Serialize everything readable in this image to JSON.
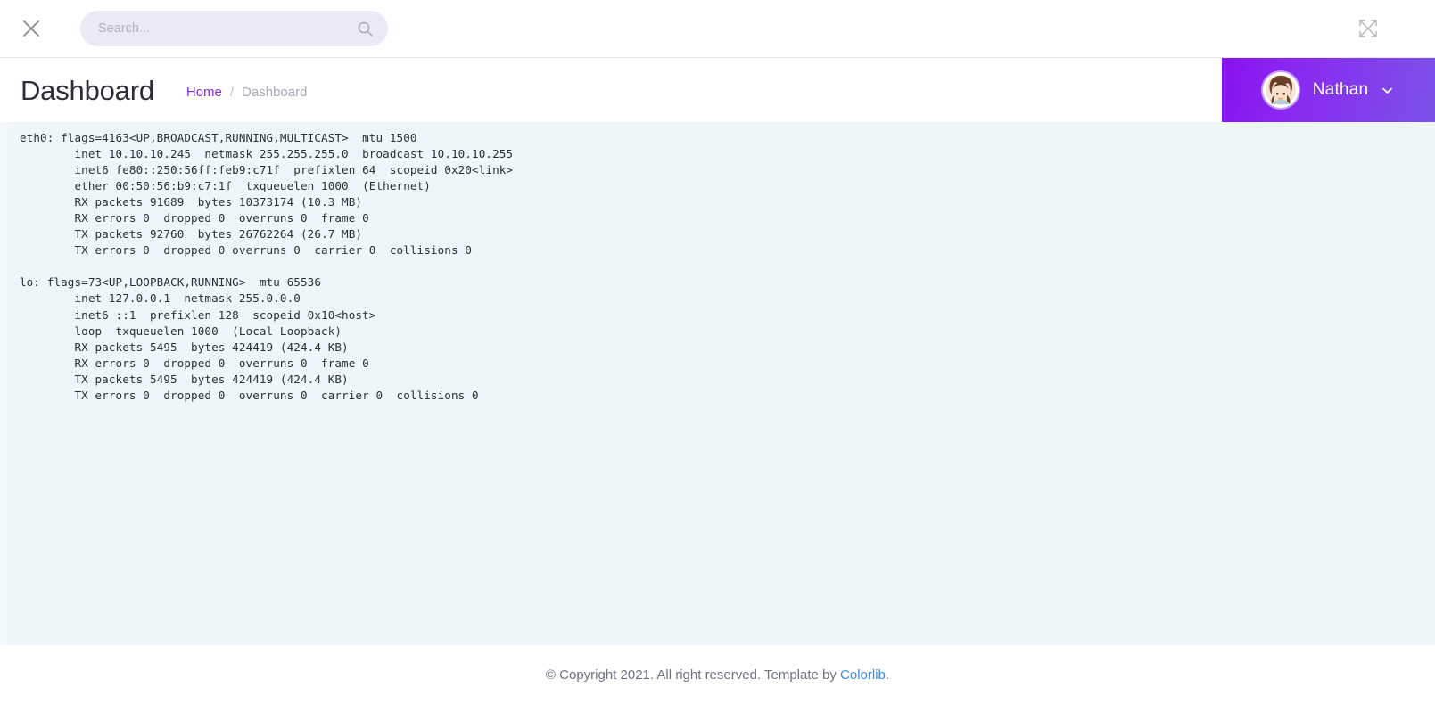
{
  "topbar": {
    "close_icon": "close-icon",
    "search": {
      "value": "",
      "placeholder": "Search...",
      "icon": "search-icon"
    },
    "fullscreen_icon": "expand-icon"
  },
  "header": {
    "title": "Dashboard",
    "breadcrumb": {
      "home_label": "Home",
      "separator": "/",
      "current_label": "Dashboard"
    },
    "user": {
      "name": "Nathan",
      "avatar_icon": "user-avatar",
      "caret_icon": "chevron-down-icon"
    }
  },
  "content": {
    "terminal_output": "eth0: flags=4163<UP,BROADCAST,RUNNING,MULTICAST>  mtu 1500\n        inet 10.10.10.245  netmask 255.255.255.0  broadcast 10.10.10.255\n        inet6 fe80::250:56ff:feb9:c71f  prefixlen 64  scopeid 0x20<link>\n        ether 00:50:56:b9:c7:1f  txqueuelen 1000  (Ethernet)\n        RX packets 91689  bytes 10373174 (10.3 MB)\n        RX errors 0  dropped 0  overruns 0  frame 0\n        TX packets 92760  bytes 26762264 (26.7 MB)\n        TX errors 0  dropped 0 overruns 0  carrier 0  collisions 0\n\nlo: flags=73<UP,LOOPBACK,RUNNING>  mtu 65536\n        inet 127.0.0.1  netmask 255.0.0.0\n        inet6 ::1  prefixlen 128  scopeid 0x10<host>\n        loop  txqueuelen 1000  (Local Loopback)\n        RX packets 5495  bytes 424419 (424.4 KB)\n        RX errors 0  dropped 0  overruns 0  frame 0\n        TX packets 5495  bytes 424419 (424.4 KB)\n        TX errors 0  dropped 0  overruns 0  carrier 0  collisions 0"
  },
  "footer": {
    "copyright_text": "© Copyright 2021. All right reserved. Template by ",
    "link_label": "Colorlib",
    "trailing": "."
  },
  "colors": {
    "accent_purple": "#8811f0",
    "accent_purple_end": "#7b52e8",
    "breadcrumb_link": "#8a2be2",
    "footer_link": "#3c8ce0",
    "content_bg": "#eff6fa",
    "search_bg": "#ece9f6"
  }
}
